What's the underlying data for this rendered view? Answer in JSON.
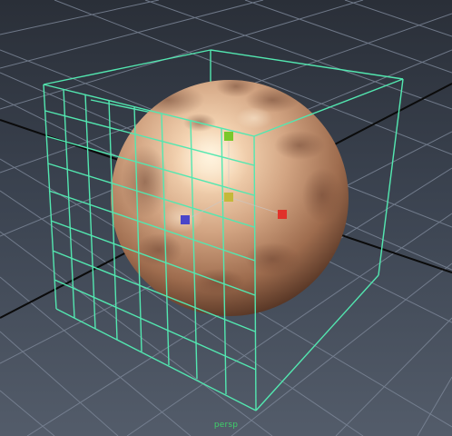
{
  "viewport": {
    "camera_label": "persp"
  },
  "colors": {
    "background_top": "#2a2f38",
    "background_bottom": "#535c6a",
    "grid_line": "#7b8596",
    "grid_axis": "#0b0b0b",
    "lattice": "#53e7b0",
    "sphere_light": "#fff1d8",
    "sphere_mid": "#cf9f7e",
    "sphere_dark": "#5a3725",
    "manipulator_x": "#e1322a",
    "manipulator_y": "#7ac82a",
    "manipulator_z": "#4a45c9",
    "manipulator_center": "#c4b93a",
    "camera_label": "#3fd06a"
  },
  "icons": {
    "axis_x_handle": "manipulator-x-handle",
    "axis_y_handle": "manipulator-y-handle",
    "axis_z_handle": "manipulator-z-handle",
    "center_handle": "manipulator-center-handle"
  }
}
